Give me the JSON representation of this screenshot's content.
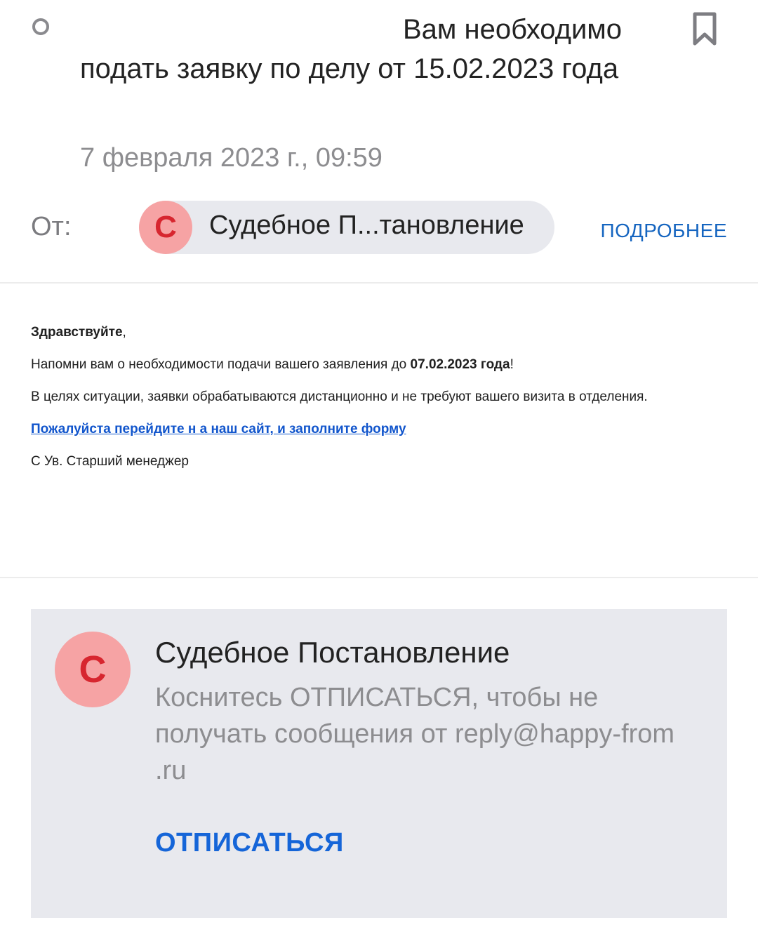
{
  "header": {
    "subject_line1": "Вам необходимо",
    "subject_rest": "подать заявку по делу от 15.02.2023 года",
    "date": "7 февраля 2023 г., 09:59",
    "from_label": "От:",
    "sender_initial": "С",
    "sender_name": "Судебное П...тановление",
    "more_label": "ПОДРОБНЕЕ"
  },
  "message": {
    "greeting": "Здравствуйте",
    "greeting_punct": ",",
    "reminder_text": "Напомни вам о необходимости подачи вашего заявления до ",
    "reminder_date": "07.02.2023 года",
    "reminder_end": "!",
    "info_text": "В целях ситуации, заявки обрабатываются дистанционно и не требуют вашего визита в отделения.",
    "link_text": "Пожалуйста перейдите н а наш сайт, и заполните форму",
    "signature": "С Ув. Старший менеджер"
  },
  "unsubscribe": {
    "avatar_initial": "С",
    "sender_full": "Судебное Постановление",
    "text": "Коснитесь ОТПИСАТЬСЯ, чтобы не получать сообщения от reply@happy-from .ru",
    "button_label": "ОТПИСАТЬСЯ"
  },
  "colors": {
    "accent_link": "#1565c0",
    "avatar_bg": "#f6a3a4",
    "avatar_text": "#d7262f",
    "panel_bg": "#e8e9ee"
  },
  "icons": {
    "unread": "unread-circle-icon",
    "bookmark": "bookmark-icon"
  }
}
